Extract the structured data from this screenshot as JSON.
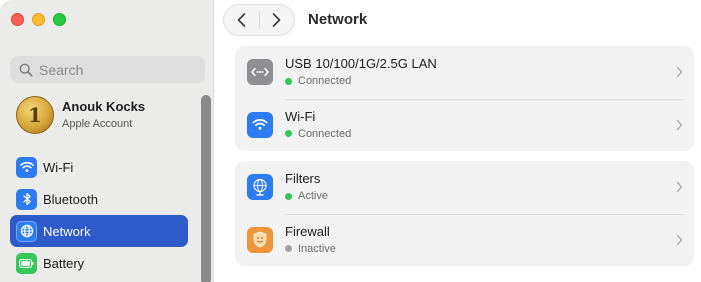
{
  "window": {
    "title": "Network"
  },
  "sidebar": {
    "search_placeholder": "Search",
    "account": {
      "name": "Anouk Kocks",
      "subtitle": "Apple Account",
      "avatar_glyph": "1"
    },
    "items": [
      {
        "label": "Wi-Fi",
        "icon": "wifi-icon",
        "color": "#2d7cf6",
        "active": false
      },
      {
        "label": "Bluetooth",
        "icon": "bluetooth-icon",
        "color": "#2d7cf6",
        "active": false
      },
      {
        "label": "Network",
        "icon": "globe-icon",
        "color": "#2d7cf6",
        "active": true
      },
      {
        "label": "Battery",
        "icon": "battery-icon",
        "color": "#34c759",
        "active": false
      }
    ]
  },
  "main": {
    "groups": [
      {
        "rows": [
          {
            "title": "USB 10/100/1G/2.5G LAN",
            "status": "Connected",
            "status_color": "#34c759",
            "icon": "ethernet-icon",
            "icon_color": "#8e8e93"
          },
          {
            "title": "Wi-Fi",
            "status": "Connected",
            "status_color": "#34c759",
            "icon": "wifi-icon",
            "icon_color": "#2d7cf6"
          }
        ]
      },
      {
        "rows": [
          {
            "title": "Filters",
            "status": "Active",
            "status_color": "#34c759",
            "icon": "globe-filter-icon",
            "icon_color": "#2d7cf6"
          },
          {
            "title": "Firewall",
            "status": "Inactive",
            "status_color": "#a0a0a0",
            "icon": "shield-icon",
            "icon_color": "#f0963a"
          }
        ]
      }
    ]
  },
  "colors": {
    "accent": "#2f5ac9",
    "sidebar_bg": "#ebebea",
    "group_bg": "#f2f2f2"
  }
}
